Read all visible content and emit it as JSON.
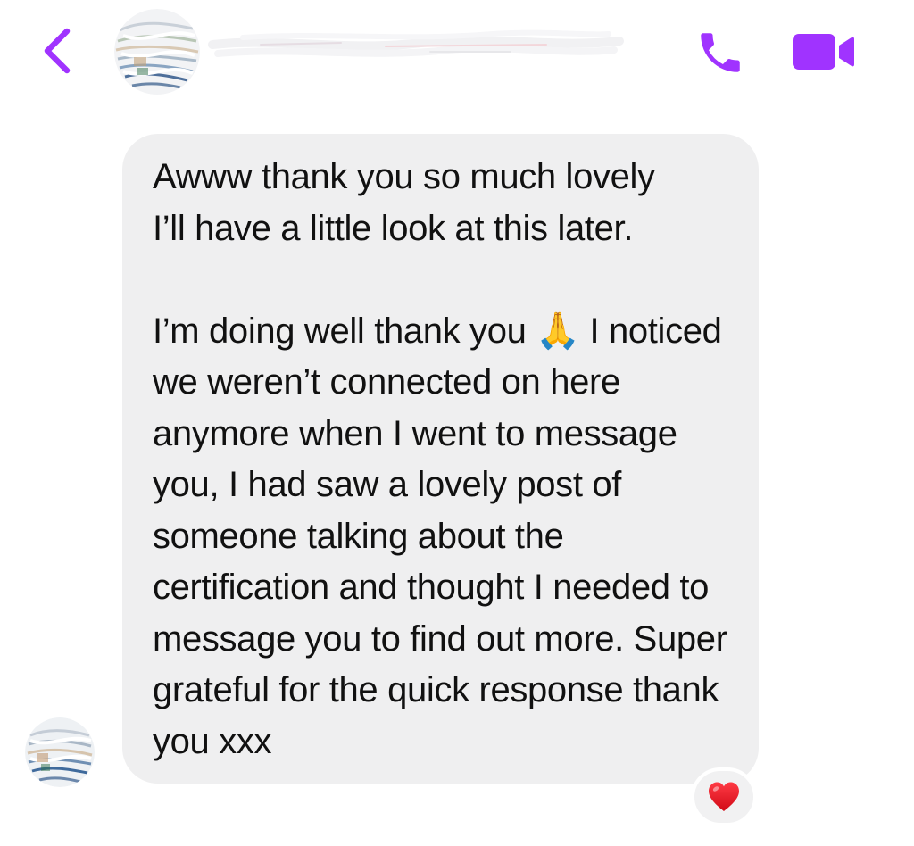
{
  "theme": {
    "accent": "#a033ff",
    "bubble_background": "#efeff0",
    "text_color": "#111111",
    "reaction_color": "#e3101d"
  },
  "header": {
    "back_icon": "chevron-left-icon",
    "avatar": "contact-avatar-scribbled",
    "contact_name": "",
    "call_icon": "phone-icon",
    "video_icon": "video-camera-icon"
  },
  "message": {
    "text": "Awww thank you so much lovely\nI’ll have a little look at this later.\n\nI’m doing well thank you 🙏 I noticed we weren’t connected on here anymore when I went to message you, I had saw a lovely post of someone talking about the certification and thought I needed to message you to find out more. Super grateful for the quick response thank you xxx",
    "sender_avatar": "sender-avatar-scribbled",
    "reaction": "❤️"
  }
}
